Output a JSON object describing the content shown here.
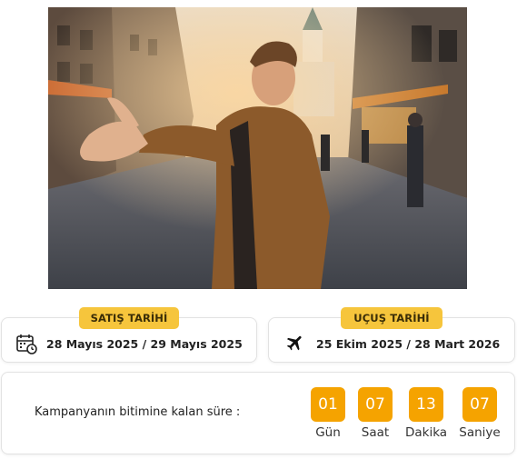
{
  "hero": {
    "icon": "traveler-photo"
  },
  "sales": {
    "tag_label": "SATIŞ TARİHİ",
    "dates": "28 Mayıs 2025 / 29 Mayıs 2025",
    "icon": "calendar-clock-icon"
  },
  "flight": {
    "tag_label": "UÇUŞ TARİHİ",
    "dates": "25 Ekim 2025 / 28 Mart 2026",
    "icon": "airplane-icon"
  },
  "countdown": {
    "label": "Kampanyanın bitimine kalan süre :",
    "units": [
      {
        "value": "01",
        "label": "Gün"
      },
      {
        "value": "07",
        "label": "Saat"
      },
      {
        "value": "13",
        "label": "Dakika"
      },
      {
        "value": "07",
        "label": "Saniye"
      }
    ]
  },
  "colors": {
    "tag_yellow": "#f6c53c",
    "countdown_orange": "#f5a300",
    "text_dark": "#222222",
    "card_border": "#e2e2e2"
  }
}
